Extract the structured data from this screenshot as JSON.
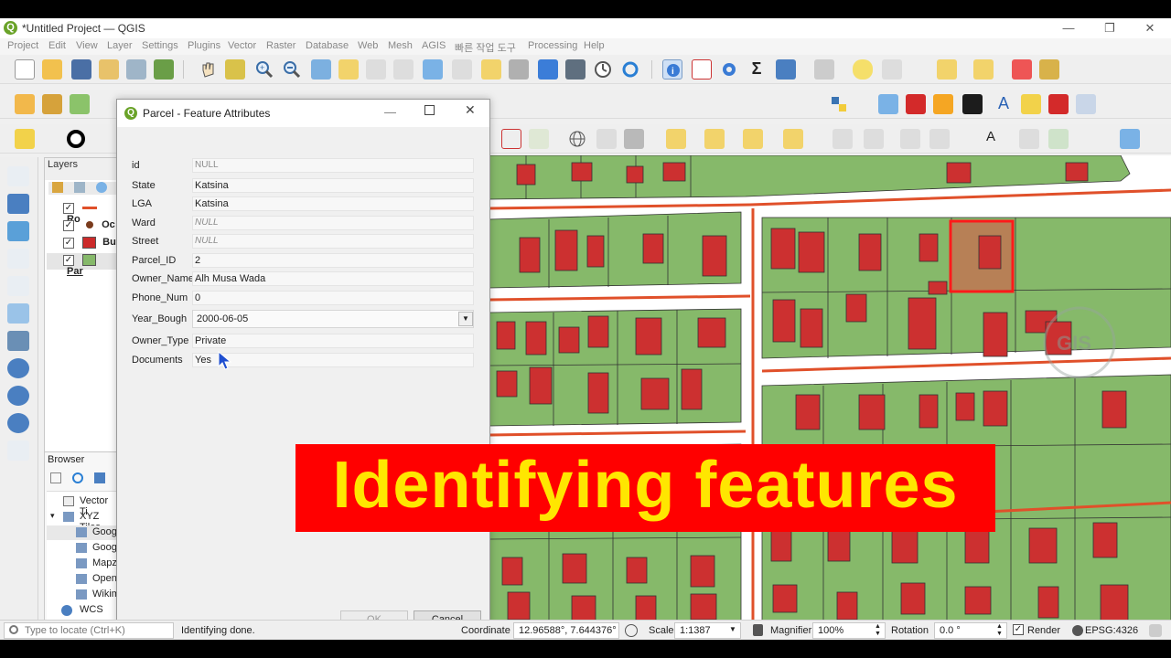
{
  "window": {
    "title": "*Untitled Project — QGIS",
    "logo_letter": "Q"
  },
  "menu": [
    "Project",
    "Edit",
    "View",
    "Layer",
    "Settings",
    "Plugins",
    "Vector",
    "Raster",
    "Database",
    "Web",
    "Mesh",
    "AGIS",
    "빠른 작업 도구",
    "Processing",
    "Help"
  ],
  "layers_panel": {
    "title": "Layers",
    "items": [
      {
        "label": "Ro",
        "symbol": "line",
        "color": "#e0502a"
      },
      {
        "label": "Oc",
        "symbol": "point",
        "color": "#7a3b1d"
      },
      {
        "label": "Bu",
        "symbol": "fill",
        "color": "#cc2b2b"
      },
      {
        "label": "Par",
        "symbol": "fill",
        "color": "#86b96a"
      }
    ]
  },
  "browser_panel": {
    "title": "Browser",
    "items": [
      "Vector Ti",
      "XYZ Tiles",
      "Googl",
      "Googl",
      "Mapz",
      "Open",
      "Wikim",
      "WCS"
    ]
  },
  "dialog": {
    "title": "Parcel - Feature Attributes",
    "fields": [
      {
        "label": "id",
        "value": "NULL",
        "null": true
      },
      {
        "label": "State",
        "value": "Katsina",
        "null": false
      },
      {
        "label": "LGA",
        "value": "Katsina",
        "null": false
      },
      {
        "label": "Ward",
        "value": "NULL",
        "null": true
      },
      {
        "label": "Street",
        "value": "NULL",
        "null": true
      },
      {
        "label": "Parcel_ID",
        "value": "2",
        "null": false
      },
      {
        "label": "Owner_Name",
        "value": "Alh Musa Wada",
        "null": false
      },
      {
        "label": "Phone_Num",
        "value": "0",
        "null": false
      },
      {
        "label": "Year_Bough",
        "value": "2000-06-05",
        "null": false
      },
      {
        "label": "Owner_Type",
        "value": "Private",
        "null": false
      },
      {
        "label": "Documents",
        "value": "Yes",
        "null": false
      }
    ],
    "ok_label": "OK",
    "cancel_label": "Cancel"
  },
  "banner": {
    "text": "Identifying features"
  },
  "status": {
    "locate_placeholder": "Type to locate (Ctrl+K)",
    "message": "Identifying done.",
    "coordinate_label": "Coordinate",
    "coordinate_value": "12.96588°, 7.644376°",
    "scale_label": "Scale",
    "scale_value": "1:1387",
    "magnifier_label": "Magnifier",
    "magnifier_value": "100%",
    "rotation_label": "Rotation",
    "rotation_value": "0.0 °",
    "render_label": "Render",
    "crs": "EPSG:4326"
  },
  "colors": {
    "parcel": "#86b96a",
    "building": "#cc3030",
    "road": "#e0502a",
    "highlight": "#ff1a1a",
    "banner": "#ff0000",
    "banner_text": "#ffe600"
  },
  "map_overlay_logo": "GIS"
}
